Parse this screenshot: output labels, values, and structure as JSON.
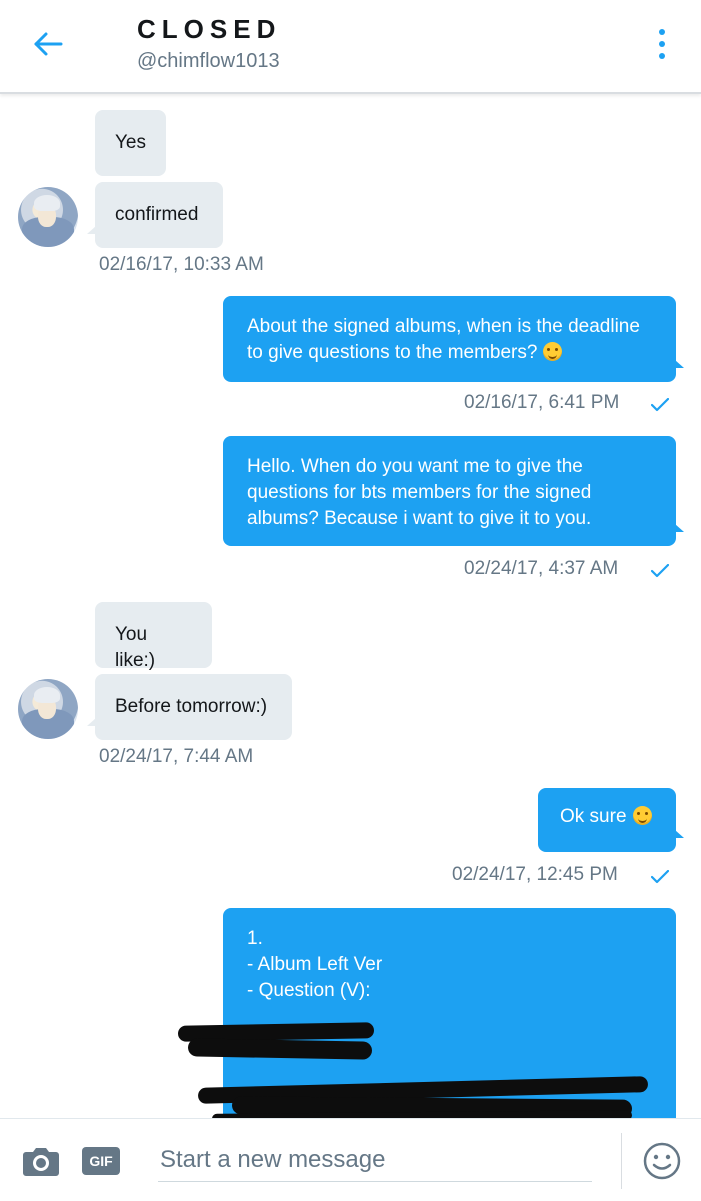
{
  "header": {
    "title": "CLOSED",
    "handle": "@chimflow1013"
  },
  "messages": [
    {
      "side": "in",
      "text": "Yes"
    },
    {
      "side": "in",
      "text": "confirmed"
    },
    {
      "side": "in",
      "timestamp": "02/16/17, 10:33 AM"
    },
    {
      "side": "out",
      "text": "About the signed albums, when is the deadline to give questions to the members?",
      "emoji": "smiling-face",
      "timestamp": "02/16/17, 6:41 PM",
      "read": true
    },
    {
      "side": "out",
      "text": "Hello. When do you want me to give the questions for bts members for the signed albums? Because i want to give it to you.",
      "timestamp": "02/24/17, 4:37 AM",
      "read": true
    },
    {
      "side": "in",
      "text": "You like:)"
    },
    {
      "side": "in",
      "text": "Before tomorrow:)"
    },
    {
      "side": "in",
      "timestamp": "02/24/17, 7:44 AM"
    },
    {
      "side": "out",
      "text": "Ok sure",
      "emoji": "grinning-face",
      "timestamp": "02/24/17, 12:45 PM",
      "read": true
    },
    {
      "side": "out",
      "lines": [
        "1.",
        "- Album Left Ver",
        "- Question (V):"
      ],
      "redacted": true
    }
  ],
  "composer": {
    "gif_label": "GIF",
    "placeholder": "Start a new message"
  },
  "colors": {
    "accent": "#1da1f2",
    "incoming_bubble": "#e6ecf0",
    "muted_text": "#657786"
  }
}
